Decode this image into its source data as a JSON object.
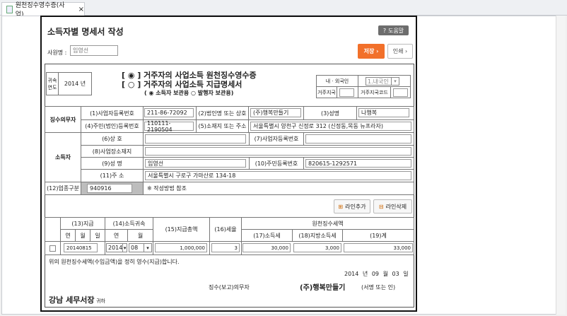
{
  "tab": {
    "title": "원천징수영수증(사업)",
    "close": "×"
  },
  "dialog": {
    "title": "소득자별 명세서 작성",
    "help_label": "도움말",
    "employee_label": "사원명 :",
    "employee_value": "임영선",
    "save_label": "저장 ›",
    "print_label": "인쇄 ›"
  },
  "header": {
    "year_label": "귀속연도",
    "year_value": "2014 년",
    "title1": "거주자의 사업소득 원천징수영수증",
    "title2": "거주자의 사업소득 지급명세서",
    "copy_income": "소득자 보관용",
    "copy_issuer": "발행자 보관용",
    "nationality_label": "내 · 외국인",
    "nationality_value": "1.내국인",
    "residence_label": "거주지국",
    "residence_code_label": "거주지국코드"
  },
  "payer": {
    "section": "징수의무자",
    "biz_no_label": "(1)사업자등록번호",
    "biz_no": "211-86-72092",
    "corp_name_label": "(2)법인명 또는 상호",
    "corp_name": "(주)행복만들기",
    "name_label": "(3)성명",
    "name": "나행복",
    "reg_no_label": "(4)주민(법인)등록번호",
    "reg_no": "110111-2190504",
    "address_label": "(5)소재지 또는 주소",
    "address": "서울특별시 양천구 신정로 312 (신정동,목동 뉴프라자)"
  },
  "earner": {
    "section": "소득자",
    "trade_name_label": "(6)상 호",
    "trade_name": "",
    "biz_no_label": "(7)사업자등록번호",
    "biz_no": "",
    "workplace_label": "(8)사업장소재지",
    "workplace": "",
    "name_label": "(9)성 명",
    "name": "임영선",
    "rrn_label": "(10)주민등록번호",
    "rrn": "820615-1292571",
    "address_label": "(11)주 소",
    "address": "서울특별시 구로구 가마산로 134-18",
    "industry_label": "(12)업종구분",
    "industry": "940916",
    "industry_note": "※ 작성방법 참조"
  },
  "lines": {
    "add_label": "라인추가",
    "delete_label": "라인삭제",
    "headers": {
      "pay": "(13)지급",
      "attr": "(14)소득귀속",
      "total": "(15)지급총액",
      "rate": "(16)세율",
      "withholding": "원천징수세액",
      "income_tax": "(17)소득세",
      "local_tax": "(18)지방소득세",
      "sum": "(19)계",
      "y": "연",
      "m": "월",
      "d": "일"
    },
    "rows": [
      {
        "pay_date": "20140815",
        "attr_year": "2014",
        "attr_month": "08",
        "total": "1,000,000",
        "rate": "3",
        "income_tax": "30,000",
        "local_tax": "3,000",
        "sum": "33,000"
      }
    ]
  },
  "footer": {
    "statement": "위의 원천징수세액(수입금액)을 정히 영수(지급)합니다.",
    "year": "2014",
    "year_unit": "년",
    "month": "09",
    "month_unit": "월",
    "day": "03",
    "day_unit": "일",
    "payer_label": "징수(보고)의무자",
    "payer_name": "(주)행복만들기",
    "sign": "(서명 또는 인)",
    "office": "강남 세무서장",
    "honorific": "귀하"
  }
}
